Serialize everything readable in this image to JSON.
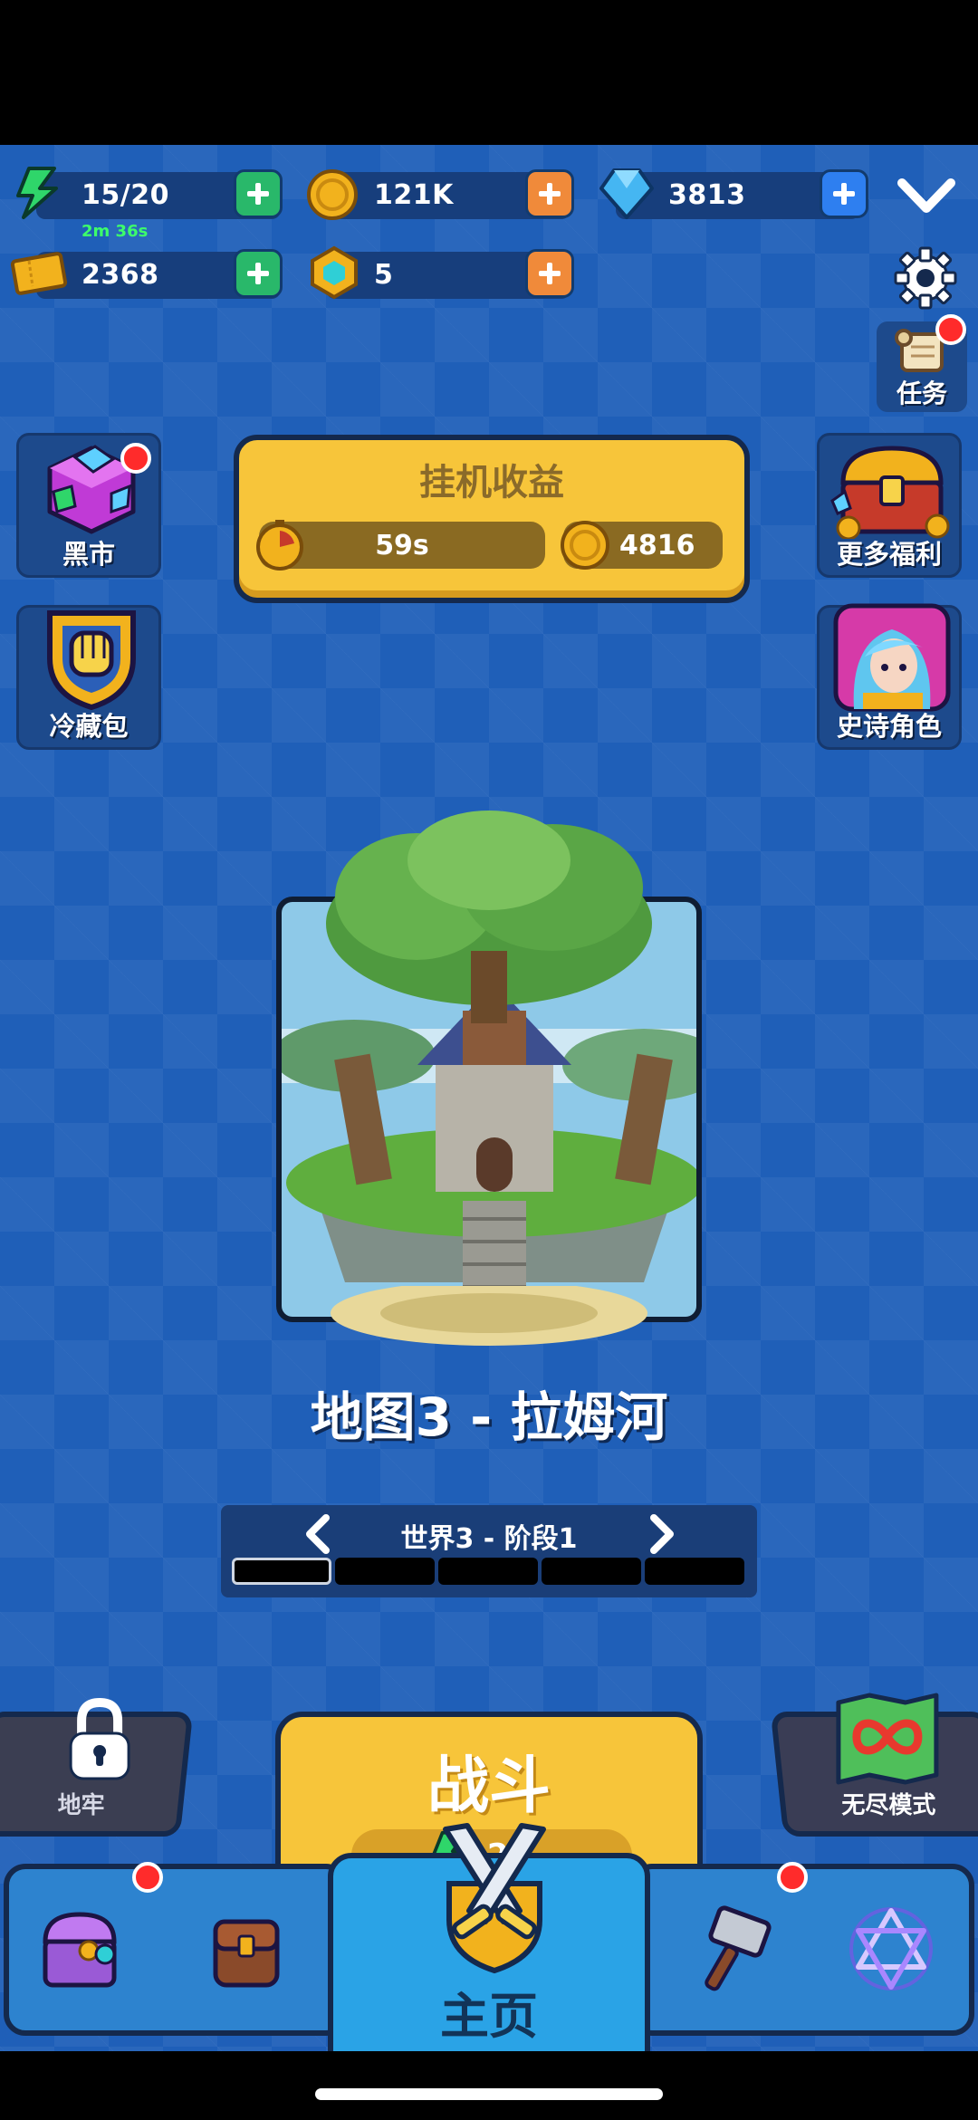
{
  "resources": {
    "energy": {
      "value": "15/20",
      "timer": "2m 36s"
    },
    "gold": {
      "value": "121K"
    },
    "gems": {
      "value": "3813"
    },
    "tickets": {
      "value": "2368"
    },
    "tokens": {
      "value": "5"
    }
  },
  "side": {
    "left": [
      {
        "label": "黑市",
        "icon": "gem-cube-icon"
      },
      {
        "label": "冷藏包",
        "icon": "golden-fist-icon"
      }
    ],
    "right": [
      {
        "label": "任务",
        "icon": "scroll-icon"
      },
      {
        "label": "更多福利",
        "icon": "treasure-chest-icon"
      },
      {
        "label": "史诗角色",
        "icon": "hero-portrait-icon"
      }
    ]
  },
  "idle": {
    "title": "挂机收益",
    "timer": "59s",
    "gold": "4816"
  },
  "map": {
    "title": "地图3 - 拉姆河",
    "stage": "世界3 - 阶段1",
    "stage_count": 5,
    "stage_active": 1
  },
  "battle": {
    "label": "战斗",
    "cost": "2"
  },
  "modes": {
    "dungeon": "地牢",
    "endless": "无尽模式"
  },
  "nav": {
    "home": "主页",
    "items": [
      "chest-icon",
      "backpack-icon",
      "crossed-swords-icon",
      "hammer-icon",
      "hexagram-icon"
    ]
  },
  "colors": {
    "background": "#1f5fb8",
    "button_yellow": "#f7c53a",
    "plus_green": "#29b86a",
    "plus_orange": "#f08a3a",
    "plus_blue": "#2e7ff0",
    "notification_red": "#ff2b2b"
  }
}
